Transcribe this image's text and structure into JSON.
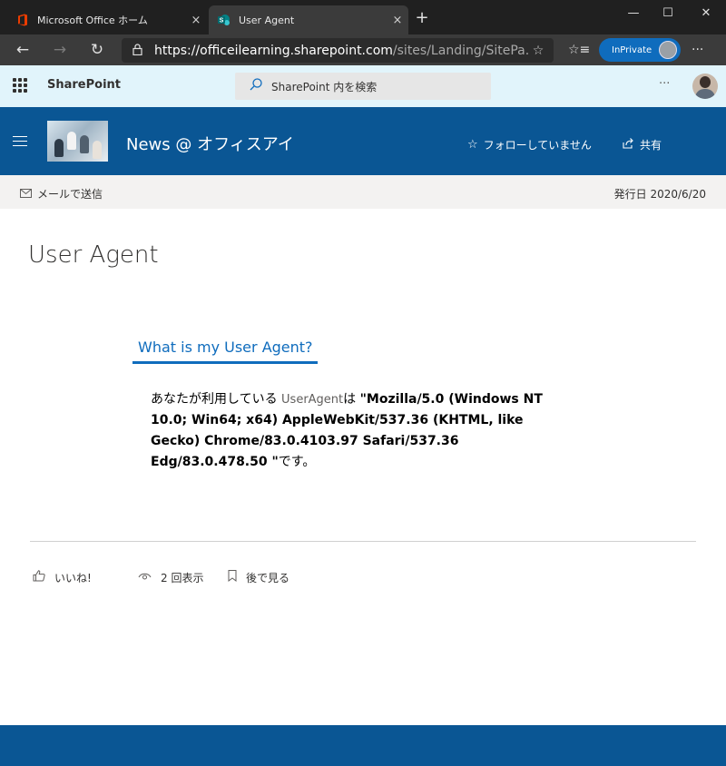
{
  "browser": {
    "tabs": [
      {
        "title": "Microsoft Office ホーム",
        "close": "×"
      },
      {
        "title": "User Agent",
        "close": "×"
      }
    ],
    "new_tab": "+",
    "window_controls": {
      "minimize": "—",
      "maximize": "☐",
      "close": "✕"
    },
    "url_host": "https://officeilearning.sharepoint.com",
    "url_path": "/sites/Landing/SitePa...",
    "inprivate_label": "InPrivate",
    "more": "···"
  },
  "suite": {
    "brand": "SharePoint",
    "search_placeholder": "SharePoint 内を検索",
    "more": "···"
  },
  "site": {
    "name": "News @ オフィスアイ",
    "follow_label": "フォローしていません",
    "share_label": "共有"
  },
  "commandbar": {
    "mail_label": "メールで送信",
    "published": "発行日 2020/6/20"
  },
  "page": {
    "title": "User Agent",
    "section_title": "What is my User Agent?",
    "body_prefix": "あなたが利用している ",
    "body_ua_word": "UserAgent",
    "body_mid": "は ",
    "body_ua_value": "\"Mozilla/5.0 (Windows NT 10.0; Win64; x64) AppleWebKit/537.36 (KHTML, like Gecko) Chrome/83.0.4103.97 Safari/537.36 Edg/83.0.478.50 \"",
    "body_suffix": "です。"
  },
  "social": {
    "like_label": "いいね!",
    "views_label": "2 回表示",
    "save_label": "後で見る"
  },
  "colors": {
    "brand_blue": "#0a5694",
    "accent": "#0f6cbd",
    "suitebar_bg": "#e1f4fb"
  }
}
